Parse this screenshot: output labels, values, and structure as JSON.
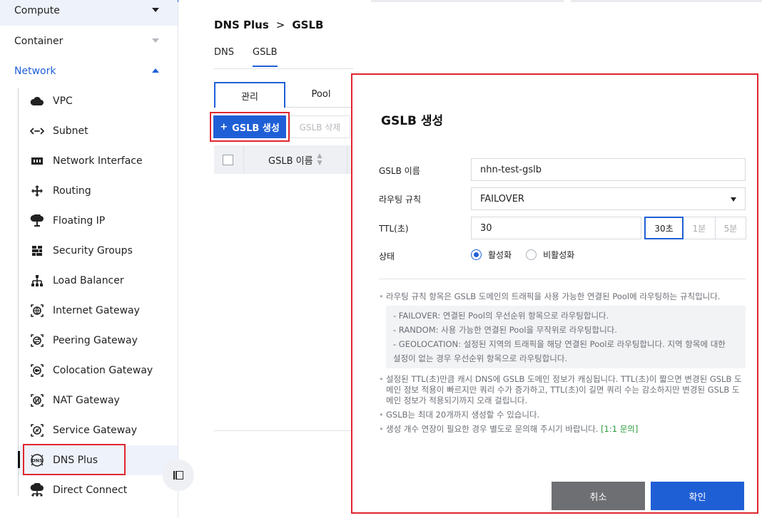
{
  "sidebar": {
    "categories": [
      {
        "label": "Compute",
        "caret": "chevron-down"
      },
      {
        "label": "Container",
        "caret": "chevron-down"
      },
      {
        "label": "Network",
        "caret": "chevron-up"
      }
    ],
    "items": [
      {
        "label": "VPC",
        "icon": "cloud-icon"
      },
      {
        "label": "Subnet",
        "icon": "subnet-icon"
      },
      {
        "label": "Network Interface",
        "icon": "network-interface-icon"
      },
      {
        "label": "Routing",
        "icon": "routing-icon"
      },
      {
        "label": "Floating IP",
        "icon": "floating-ip-icon"
      },
      {
        "label": "Security Groups",
        "icon": "security-groups-icon"
      },
      {
        "label": "Load Balancer",
        "icon": "load-balancer-icon"
      },
      {
        "label": "Internet Gateway",
        "icon": "internet-gateway-icon"
      },
      {
        "label": "Peering Gateway",
        "icon": "peering-gateway-icon"
      },
      {
        "label": "Colocation Gateway",
        "icon": "colocation-gateway-icon"
      },
      {
        "label": "NAT Gateway",
        "icon": "nat-gateway-icon"
      },
      {
        "label": "Service Gateway",
        "icon": "service-gateway-icon"
      },
      {
        "label": "DNS Plus",
        "icon": "dns-icon",
        "active": true
      },
      {
        "label": "Direct Connect",
        "icon": "direct-connect-icon"
      }
    ]
  },
  "main": {
    "breadcrumb": {
      "service": "DNS Plus",
      "page": "GSLB",
      "separator": ">"
    },
    "subtabs": [
      "DNS",
      "GSLB"
    ],
    "tabs": [
      "관리",
      "Pool"
    ],
    "toolbar": {
      "create_label": "GSLB 생성",
      "create_icon": "+",
      "delete_label": "GSLB 삭제"
    },
    "table": {
      "column_name": "GSLB 이름"
    }
  },
  "modal": {
    "title": "GSLB 생성",
    "fields": {
      "name_label": "GSLB 이름",
      "name_value": "nhn-test-gslb",
      "routing_label": "라우팅 규칙",
      "routing_value": "FAILOVER",
      "ttl_label": "TTL(초)",
      "ttl_value": "30",
      "ttl_options": [
        "30초",
        "1분",
        "5분"
      ],
      "status_label": "상태",
      "status_options": [
        "활성화",
        "비활성화"
      ]
    },
    "notes": {
      "routing_desc": "라우팅 규칙 항목은 GSLB 도메인의 트래픽을 사용 가능한 연결된 Pool에 라우팅하는 규칙입니다.",
      "routing_items": [
        "- FAILOVER: 연결된 Pool의 우선순위 항목으로 라우팅합니다.",
        "- RANDOM: 사용 가능한 연결된 Pool을 무작위로 라우팅합니다.",
        "- GEOLOCATION: 설정된 지역의 트래픽을 해당 연결된 Pool로 라우팅합니다. 지역 항목에 대한 설정이 없는 경우 우선순위 항목으로 라우팅합니다."
      ],
      "ttl_desc": "설정된 TTL(초)만큼 캐시 DNS에 GSLB 도메인 정보가 캐싱됩니다. TTL(초)이 짧으면 변경된 GSLB 도메인 정보 적용이 빠르지만 쿼리 수가 증가하고, TTL(초)이 길면 쿼리 수는 감소하지만 변경된 GSLB 도메인 정보가 적용되기까지 오래 걸립니다.",
      "max_desc": "GSLB는 최대 20개까지 생성할 수 있습니다.",
      "inquiry_desc": "생성 개수 연장이 필요한 경우 별도로 문의해 주시기 바랍니다.",
      "inquiry_link": "[1:1 문의]"
    },
    "buttons": {
      "cancel": "취소",
      "confirm": "확인"
    }
  },
  "colors": {
    "accent": "#1f5fd6",
    "highlight": "#e0262f",
    "link": "#2b9a3e"
  }
}
